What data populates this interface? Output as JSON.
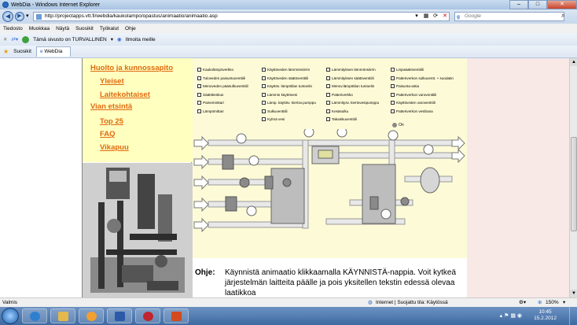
{
  "window": {
    "title": "WebDia - Windows Internet Explorer"
  },
  "address": {
    "url": "http://projectapps.vtt.fi/webdia/kaukolampo/opastus/animaatio/animaatio.asp",
    "search_placeholder": "Google"
  },
  "menu": [
    "Tiedosto",
    "Muokkaa",
    "Näytä",
    "Suosikit",
    "Työkalut",
    "Ohje"
  ],
  "security": {
    "label": "Tämä sivusto on TURVALLINEN",
    "report": "Ilmoita meille"
  },
  "favorites": {
    "label": "Suosikit",
    "tab": "WebDia"
  },
  "nav": [
    {
      "label": "Huolto ja kunnossapito"
    },
    {
      "label": "Yleiset"
    },
    {
      "label": "Laitekohtaiset"
    },
    {
      "label": "Vian etsintä"
    },
    {
      "label": "Top 25"
    },
    {
      "label": "FAQ"
    },
    {
      "label": "Vikapuu"
    }
  ],
  "checkboxes": [
    [
      "Kaukolämpöverkko",
      "Tuloveden paisuntuventtiili",
      "Menoveden pääsulkuventtiili",
      "Säätökeskus",
      "Paineminttari",
      "Lämpömittari"
    ],
    [
      "Käyttöveden lämmönsiirrin",
      "Käyttöveden säätöventtiili",
      "Käyttöv. lämpötilan tuntoelin",
      "Lämmin käyttövesi",
      "Lämp. käyttöv. kiertov.pumppu",
      "Sulkuventtiili",
      "Kylmä vesi"
    ],
    [
      "Lämmityksen lämmönsiirrin",
      "Lämmityksen säätöventtiili",
      "Menov.lämpötilan tuntoelin",
      "Patteriverkko",
      "Lämmitysv. kiertovesipumppu",
      "Kesäsulku",
      "Takaiskuventtiili"
    ],
    [
      "Linjasäätöventtiili",
      "Patteriverkon sulkuventt. + suodatin",
      "Paisunta-astia",
      "Patteriverkon varoventtiili",
      "Käyttöveden varoventtiili",
      "Patteriverkon vesihana"
    ]
  ],
  "on_label": "On",
  "instructions": {
    "label": "Ohje:",
    "text": "Käynnistä animaatio klikkaamalla KÄYNNISTÄ-nappia. Voit kytkeä järjestelmän laitteita päälle ja pois yksitellen tekstin edessä olevaa laatikkoa"
  },
  "status": {
    "left": "Valmis",
    "zone": "Internet | Suojattu tila: Käytössä",
    "zoom": "150%"
  },
  "clock": {
    "time": "10:45",
    "date": "15.2.2012"
  }
}
